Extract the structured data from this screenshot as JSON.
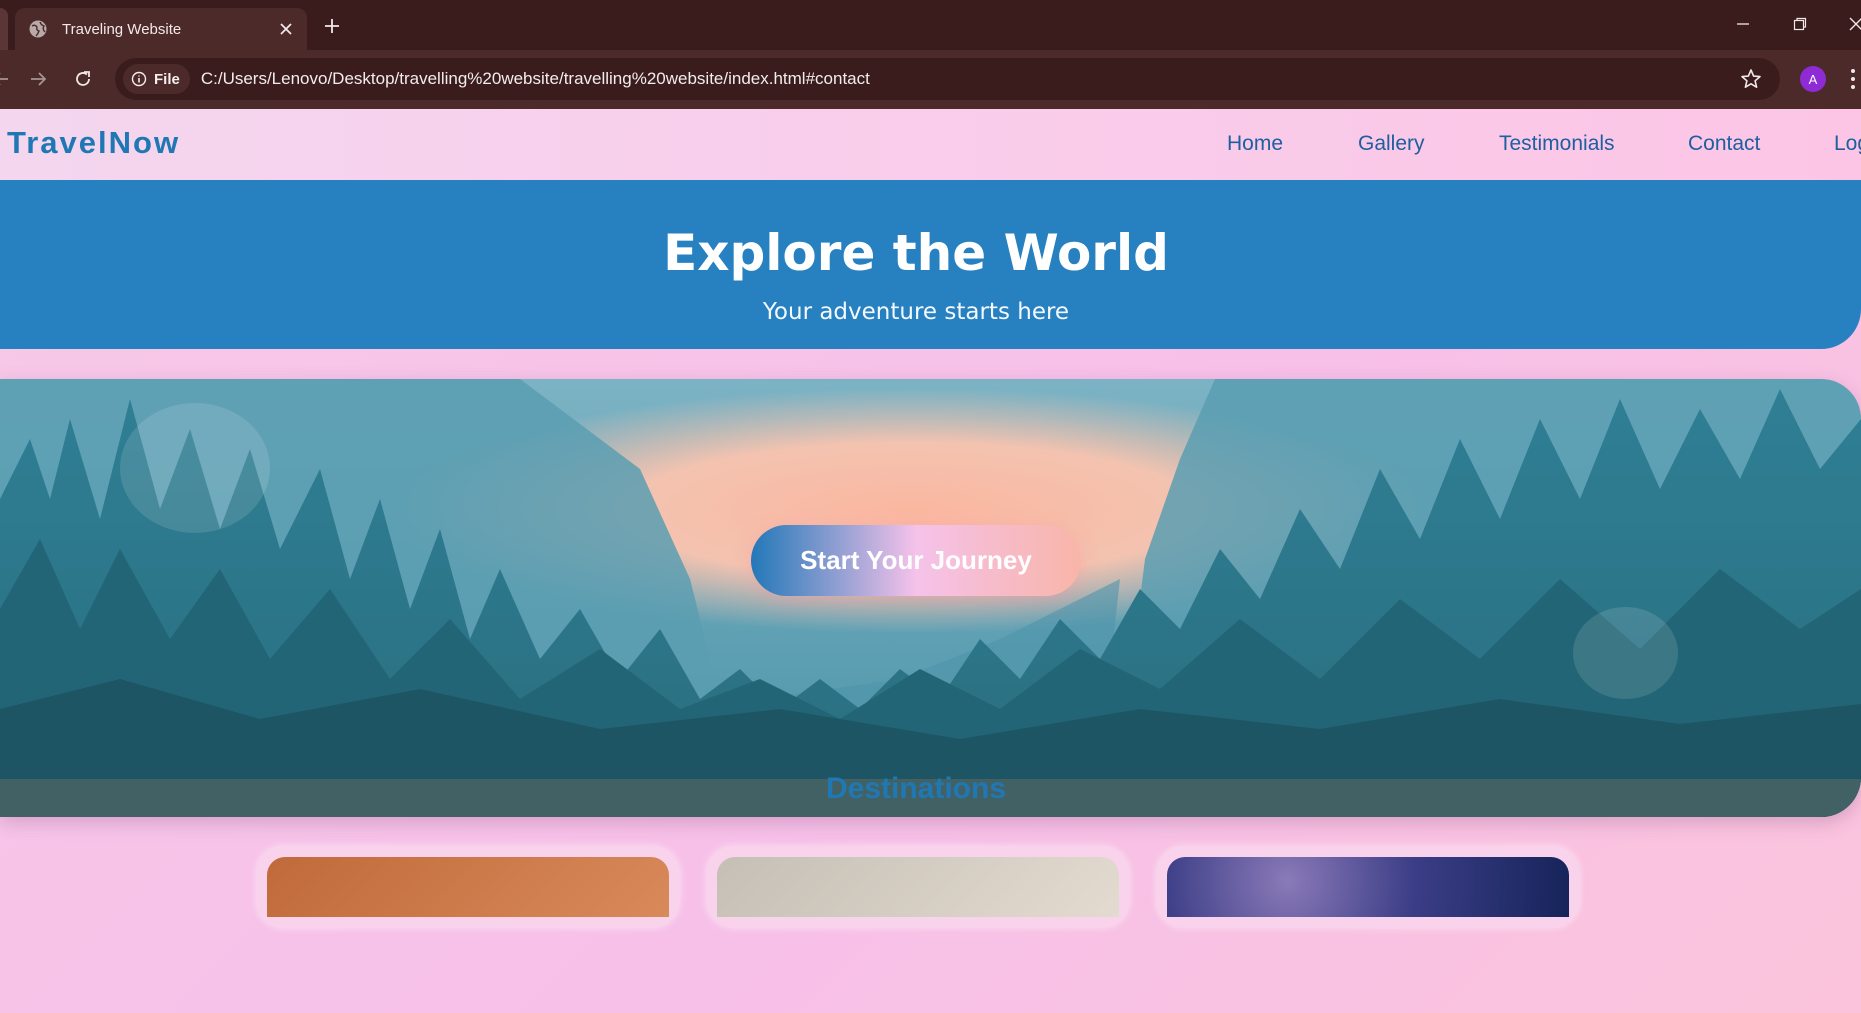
{
  "browser": {
    "tab_title": "Traveling Website",
    "site_chip_label": "File",
    "url": "C:/Users/Lenovo/Desktop/travelling%20website/travelling%20website/index.html#contact",
    "profile_initial": "A",
    "icons": [
      "globe-icon",
      "close-icon",
      "plus-icon",
      "minimize-icon",
      "restore-icon",
      "window-close-icon",
      "back-icon",
      "forward-icon",
      "reload-icon",
      "info-icon",
      "star-icon",
      "kebab-menu-icon"
    ]
  },
  "site": {
    "logo": "TravelNow",
    "nav": {
      "home": "Home",
      "gallery": "Gallery",
      "testimonials": "Testimonials",
      "contact": "Contact",
      "login": "Log"
    },
    "hero": {
      "title": "Explore the World",
      "subtitle": "Your adventure starts here",
      "cta": "Start Your Journey"
    },
    "destinations": {
      "heading": "Destinations"
    }
  },
  "colors": {
    "brand": "#1f78b4",
    "banner": "#2780c0",
    "page_bg": "#f7c3e8",
    "chrome": "#3a1c1c"
  }
}
